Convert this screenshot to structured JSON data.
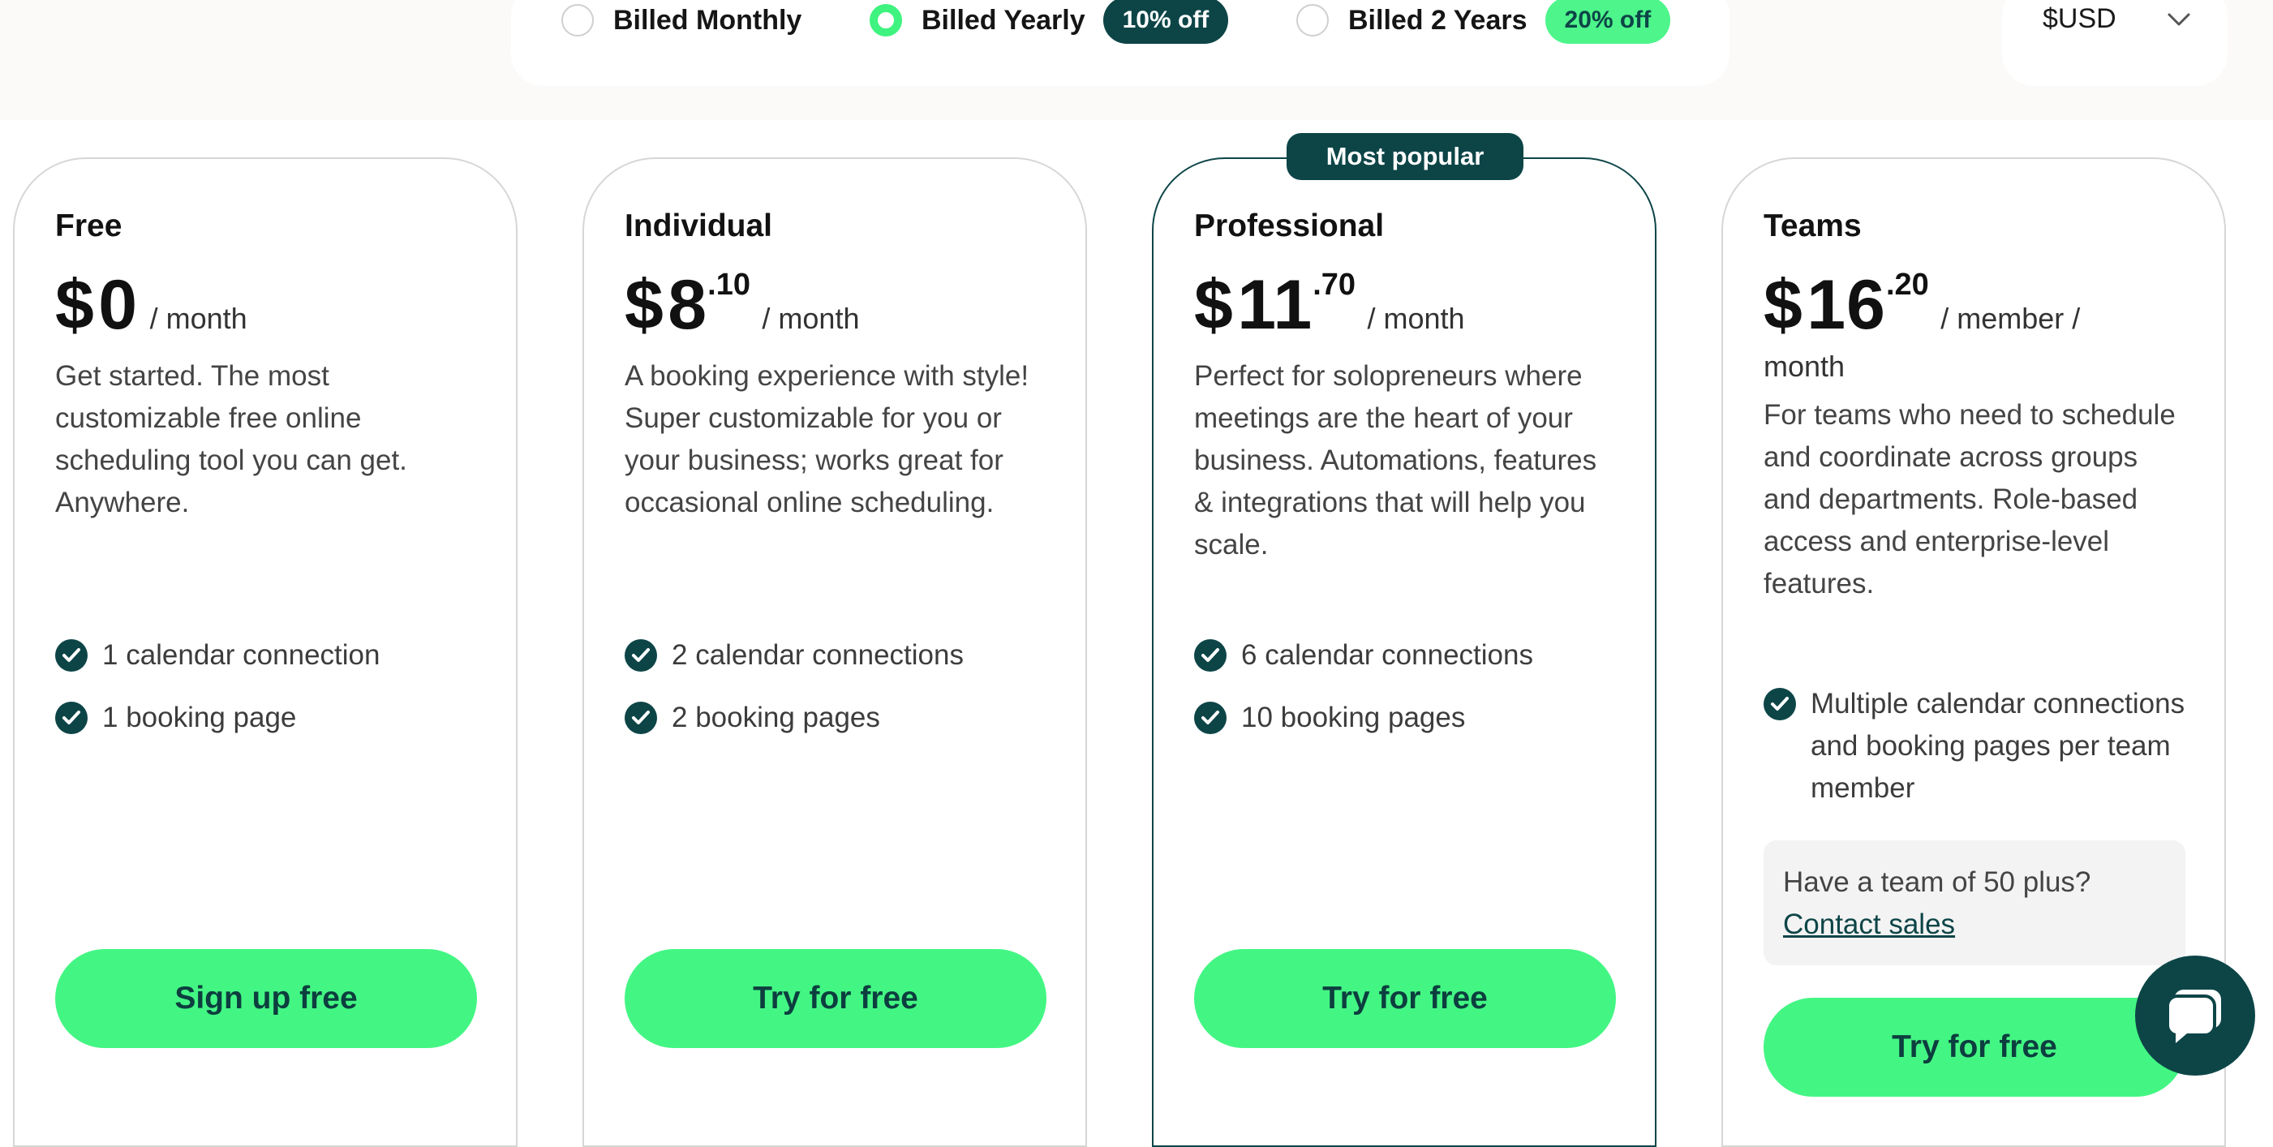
{
  "billing": {
    "options": [
      {
        "label": "Billed Monthly",
        "selected": false,
        "badge": ""
      },
      {
        "label": "Billed Yearly",
        "selected": true,
        "badge": "10% off"
      },
      {
        "label": "Billed 2 Years",
        "selected": false,
        "badge": "20% off"
      }
    ]
  },
  "currency": {
    "label": "$USD",
    "icon": "chevron-down-icon"
  },
  "featured_tag": "Most popular",
  "plans": [
    {
      "name": "Free",
      "currency_symbol": "$",
      "price": "0",
      "cents": "",
      "unit": "/ month",
      "description": "Get started. The most customizable free online scheduling tool you can get. Anywhere.",
      "features": [
        "1 calendar connection",
        "1 booking page"
      ],
      "cta": "Sign up free"
    },
    {
      "name": "Individual",
      "currency_symbol": "$",
      "price": "8",
      "cents": ".10",
      "unit": "/ month",
      "description": "A booking experience with style! Super customizable for you or your business; works great for occasional online scheduling.",
      "features": [
        "2 calendar connections",
        "2 booking pages"
      ],
      "cta": "Try for free"
    },
    {
      "name": "Professional",
      "currency_symbol": "$",
      "price": "11",
      "cents": ".70",
      "unit": "/ month",
      "description": "Perfect for solopreneurs where meetings are the heart of your business. Automations, features & integrations that will help you scale.",
      "features": [
        "6 calendar connections",
        "10 booking pages"
      ],
      "cta": "Try for free"
    },
    {
      "name": "Teams",
      "currency_symbol": "$",
      "price": "16",
      "cents": ".20",
      "unit": "/ member /",
      "unit_line2": "month",
      "description": "For teams who need to schedule and coordinate across groups and departments. Role-based access and enterprise-level features.",
      "features": [
        "Multiple calendar connections and booking pages per team member"
      ],
      "contact_text": "Have a team of 50 plus?",
      "contact_link": "Contact sales",
      "cta": "Try for free"
    }
  ],
  "colors": {
    "brand_dark": "#0d4547",
    "brand_green": "#43f683",
    "badge_green": "#4df58b"
  }
}
